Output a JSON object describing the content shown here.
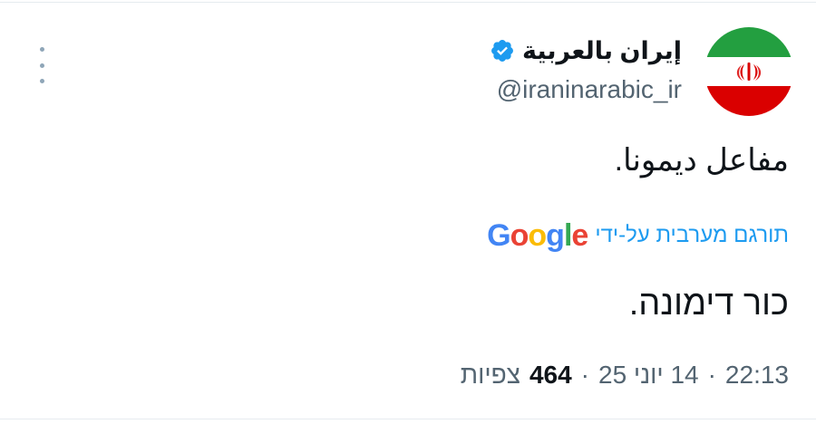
{
  "author": {
    "display_name": "إيران بالعربية",
    "handle": "@iraninarabic_ir",
    "verified": true,
    "avatar_icon": "iran-flag-icon"
  },
  "tweet": {
    "text": "مفاعل ديمونا.",
    "translated_from_label": "תורגם מערבית על-ידי",
    "translator_brand": "Google",
    "translated_text": "כור דימונה."
  },
  "meta": {
    "time": "22:13",
    "date": "14 יוני 25",
    "view_count": "464",
    "views_label": "צפיות",
    "separator": "·"
  },
  "colors": {
    "link_blue": "#1d9bf0",
    "verified_blue": "#1d9bf0",
    "secondary_text": "#536471",
    "google_blue": "#4285F4",
    "google_red": "#EA4335",
    "google_yellow": "#FBBC05",
    "google_green": "#34A853",
    "flag_green": "#239f40",
    "flag_red": "#da0000"
  }
}
